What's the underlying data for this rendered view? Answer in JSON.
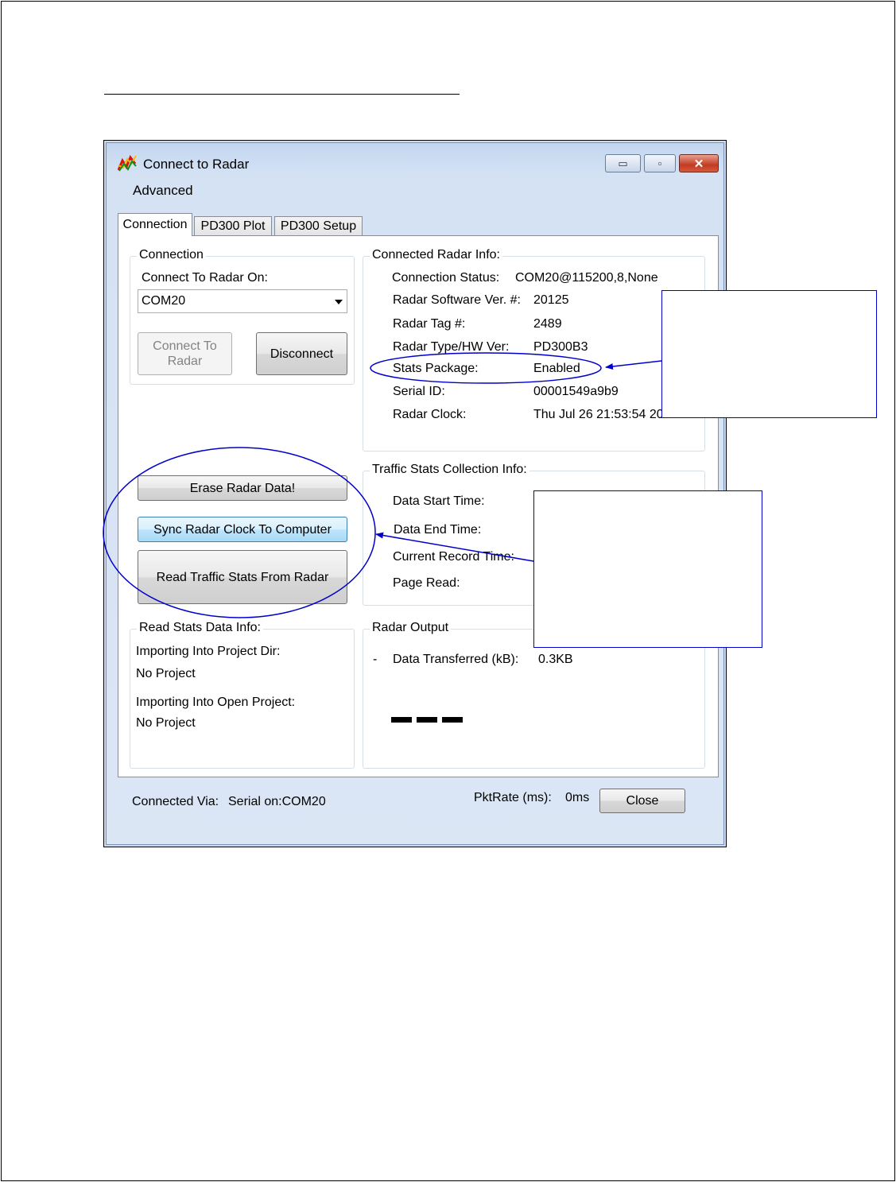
{
  "window": {
    "title": "Connect to Radar",
    "caption_buttons": {
      "minimize": "▭",
      "maximize": "▫",
      "close": "✕"
    }
  },
  "menu": {
    "advanced": "Advanced"
  },
  "tabs": [
    {
      "label": "Connection",
      "active": true
    },
    {
      "label": "PD300 Plot",
      "active": false
    },
    {
      "label": "PD300 Setup",
      "active": false
    }
  ],
  "connection": {
    "legend": "Connection",
    "connect_on_label": "Connect To Radar On:",
    "port_value": "COM20",
    "connect_button": "Connect To Radar",
    "disconnect_button": "Disconnect"
  },
  "radar_info": {
    "legend": "Connected Radar Info:",
    "rows": [
      {
        "label": "Connection Status:",
        "value": "COM20@115200,8,None"
      },
      {
        "label": "Radar Software Ver. #:",
        "value": "20125"
      },
      {
        "label": "Radar Tag #:",
        "value": "2489"
      },
      {
        "label": "Radar Type/HW Ver:",
        "value": "PD300B3"
      },
      {
        "label": "Stats Package:",
        "value": "Enabled"
      },
      {
        "label": "Serial ID:",
        "value": "00001549a9b9"
      },
      {
        "label": "Radar Clock:",
        "value": "Thu Jul 26 21:53:54 20"
      }
    ]
  },
  "actions": {
    "erase": "Erase Radar Data!",
    "sync": "Sync Radar Clock To Computer",
    "read": "Read Traffic Stats From Radar"
  },
  "traffic_stats": {
    "legend": "Traffic Stats Collection Info:",
    "rows": [
      "Data Start Time:",
      "Data End Time:",
      "Current Record Time:",
      "Page Read:"
    ]
  },
  "read_stats": {
    "legend": "Read Stats Data Info:",
    "project_dir_label": "Importing Into Project Dir:",
    "project_dir_value": "No Project",
    "open_project_label": "Importing Into Open Project:",
    "open_project_value": "No Project"
  },
  "radar_output": {
    "legend": "Radar Output",
    "bullet": "-",
    "transferred_label": "Data Transferred (kB):",
    "transferred_value": "0.3KB"
  },
  "status": {
    "connected_label": "Connected Via:",
    "connected_value": "Serial on:COM20",
    "pktrate_label": "PktRate (ms):",
    "pktrate_value": "0ms",
    "close_button": "Close"
  },
  "colors": {
    "annotation": "#0000cc"
  }
}
